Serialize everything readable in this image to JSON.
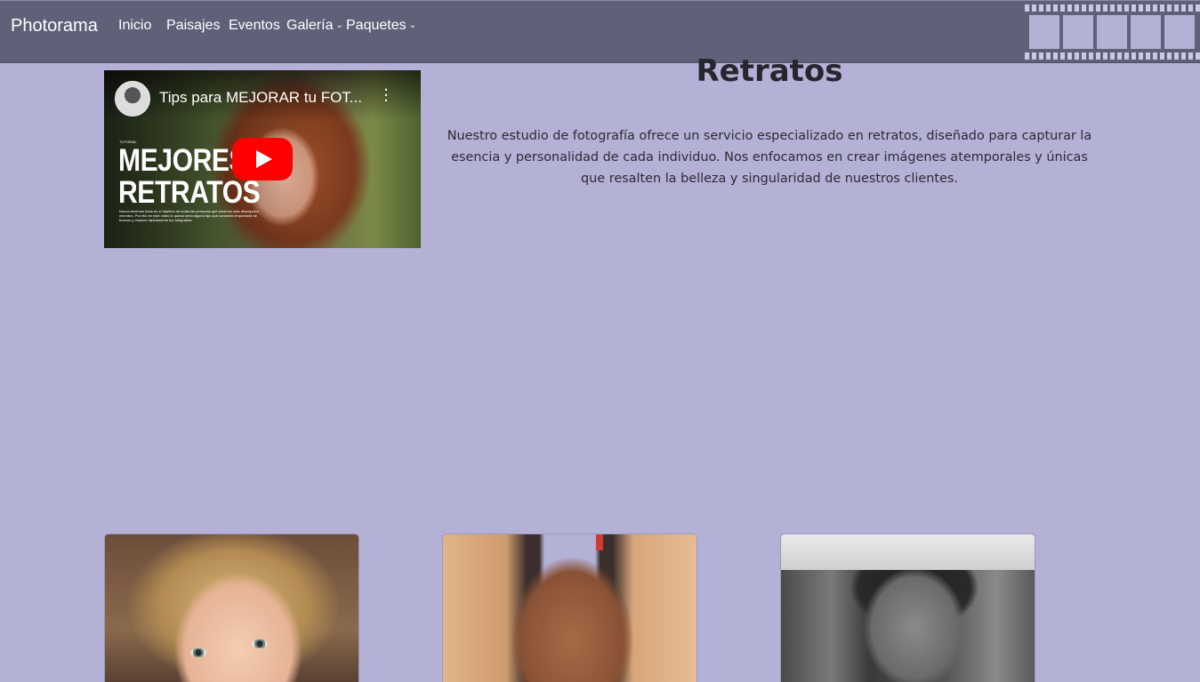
{
  "navbar": {
    "brand": "Photorama",
    "items": [
      {
        "label": "Inicio"
      },
      {
        "label": "Paisajes"
      },
      {
        "label": "Eventos"
      },
      {
        "label": "Galería",
        "dropdown": true
      },
      {
        "label": "Paquetes",
        "dropdown": true
      }
    ]
  },
  "video": {
    "title": "Tips para MEJORAR tu FOT...",
    "overlay_tag": "TUTORIAL",
    "overlay_line1": "MEJORES",
    "overlay_line2": "RETRATOS",
    "overlay_small": "Nunca tenemos fotos en el objetivo de todas las personas que amamos esta descripción miembro. Por ello en este video le queda sería alguna tips que considero importante de buenos y mejores rápidamente tus fotografías."
  },
  "main": {
    "title": "Retratos",
    "description": "Nuestro estudio de fotografía ofrece un servicio especializado en retratos, diseñado para capturar la esencia y personalidad de cada individuo. Nos enfocamos en crear imágenes atemporales y únicas que resalten la belleza y singularidad de nuestros clientes."
  },
  "colors": {
    "page_background": "#b3b1d6",
    "navbar_background": "#5f6179",
    "youtube_red": "#ff0000"
  }
}
